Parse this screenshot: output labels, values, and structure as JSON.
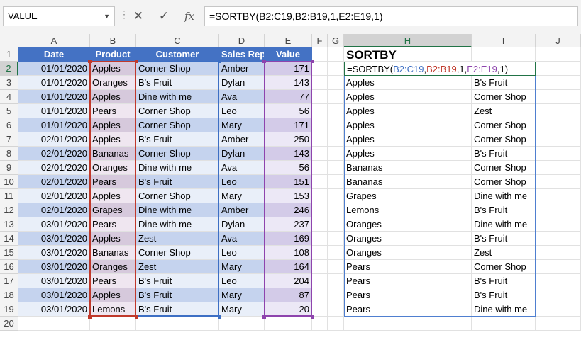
{
  "formula_bar": {
    "name_box": "VALUE",
    "cancel_icon": "✕",
    "enter_icon": "✓",
    "fx_icon": "fx",
    "formula": "=SORTBY(B2:C19,B2:B19,1,E2:E19,1)"
  },
  "columns": [
    "A",
    "B",
    "C",
    "D",
    "E",
    "F",
    "G",
    "H",
    "I",
    "J"
  ],
  "rows": [
    "1",
    "2",
    "3",
    "4",
    "5",
    "6",
    "7",
    "8",
    "9",
    "10",
    "11",
    "12",
    "13",
    "14",
    "15",
    "16",
    "17",
    "18",
    "19",
    "20"
  ],
  "table": {
    "headers": [
      "Date",
      "Product",
      "Customer",
      "Sales Rep",
      "Value"
    ],
    "rows": [
      [
        "01/01/2020",
        "Apples",
        "Corner Shop",
        "Amber",
        "171"
      ],
      [
        "01/01/2020",
        "Oranges",
        "B's Fruit",
        "Dylan",
        "143"
      ],
      [
        "01/01/2020",
        "Apples",
        "Dine with me",
        "Ava",
        "77"
      ],
      [
        "01/01/2020",
        "Pears",
        "Corner Shop",
        "Leo",
        "56"
      ],
      [
        "01/01/2020",
        "Apples",
        "Corner Shop",
        "Mary",
        "171"
      ],
      [
        "02/01/2020",
        "Apples",
        "B's Fruit",
        "Amber",
        "250"
      ],
      [
        "02/01/2020",
        "Bananas",
        "Corner Shop",
        "Dylan",
        "143"
      ],
      [
        "02/01/2020",
        "Oranges",
        "Dine with me",
        "Ava",
        "56"
      ],
      [
        "02/01/2020",
        "Pears",
        "B's Fruit",
        "Leo",
        "151"
      ],
      [
        "02/01/2020",
        "Apples",
        "Corner Shop",
        "Mary",
        "153"
      ],
      [
        "02/01/2020",
        "Grapes",
        "Dine with me",
        "Amber",
        "246"
      ],
      [
        "03/01/2020",
        "Pears",
        "Dine with me",
        "Dylan",
        "237"
      ],
      [
        "03/01/2020",
        "Apples",
        "Zest",
        "Ava",
        "169"
      ],
      [
        "03/01/2020",
        "Bananas",
        "Corner Shop",
        "Leo",
        "108"
      ],
      [
        "03/01/2020",
        "Oranges",
        "Zest",
        "Mary",
        "164"
      ],
      [
        "03/01/2020",
        "Pears",
        "B's Fruit",
        "Leo",
        "204"
      ],
      [
        "03/01/2020",
        "Apples",
        "B's Fruit",
        "Mary",
        "87"
      ],
      [
        "03/01/2020",
        "Lemons",
        "B's Fruit",
        "Mary",
        "20"
      ]
    ]
  },
  "result": {
    "title": "SORTBY",
    "formula_parts": [
      {
        "text": "=SORTBY(",
        "color": "#000000"
      },
      {
        "text": "B2:C19",
        "color": "#3d6fc4"
      },
      {
        "text": ",",
        "color": "#000000"
      },
      {
        "text": "B2:B19",
        "color": "#c0392b"
      },
      {
        "text": ",1,",
        "color": "#000000"
      },
      {
        "text": "E2:E19",
        "color": "#8e44ad"
      },
      {
        "text": ",1)",
        "color": "#000000"
      }
    ],
    "rows": [
      [
        "Apples",
        "B's Fruit"
      ],
      [
        "Apples",
        "Corner Shop"
      ],
      [
        "Apples",
        "Zest"
      ],
      [
        "Apples",
        "Corner Shop"
      ],
      [
        "Apples",
        "Corner Shop"
      ],
      [
        "Apples",
        "B's Fruit"
      ],
      [
        "Bananas",
        "Corner Shop"
      ],
      [
        "Bananas",
        "Corner Shop"
      ],
      [
        "Grapes",
        "Dine with me"
      ],
      [
        "Lemons",
        "B's Fruit"
      ],
      [
        "Oranges",
        "Dine with me"
      ],
      [
        "Oranges",
        "B's Fruit"
      ],
      [
        "Oranges",
        "Zest"
      ],
      [
        "Pears",
        "Corner Shop"
      ],
      [
        "Pears",
        "B's Fruit"
      ],
      [
        "Pears",
        "B's Fruit"
      ],
      [
        "Pears",
        "Dine with me"
      ]
    ]
  },
  "colors": {
    "header_blue": "#4472c4",
    "band_dark": "#c5d3ee",
    "band_light": "#e9eff9",
    "ref_blue": "#3d6fc4",
    "ref_red": "#c0392b",
    "ref_purple": "#8e44ad",
    "excel_green": "#217346"
  }
}
